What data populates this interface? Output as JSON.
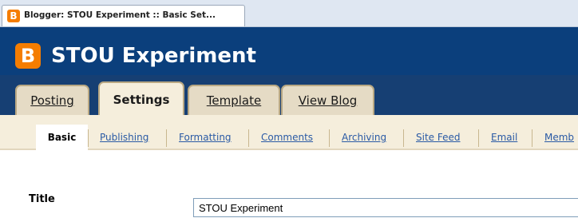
{
  "browser": {
    "tab_title": "Blogger: STOU Experiment :: Basic Set...",
    "favicon_letter": "B"
  },
  "header": {
    "logo_letter": "B",
    "blog_title": "STOU Experiment",
    "brand_color": "#f57d00"
  },
  "main_tabs": [
    {
      "label": "Posting",
      "active": false
    },
    {
      "label": "Settings",
      "active": true
    },
    {
      "label": "Template",
      "active": false
    },
    {
      "label": "View Blog",
      "active": false
    }
  ],
  "sub_tabs": [
    {
      "label": "Basic",
      "active": true
    },
    {
      "label": "Publishing",
      "active": false
    },
    {
      "label": "Formatting",
      "active": false
    },
    {
      "label": "Comments",
      "active": false
    },
    {
      "label": "Archiving",
      "active": false
    },
    {
      "label": "Site Feed",
      "active": false
    },
    {
      "label": "Email",
      "active": false
    },
    {
      "label": "Memb",
      "active": false
    }
  ],
  "form": {
    "title_label": "Title",
    "title_value": "STOU Experiment"
  }
}
